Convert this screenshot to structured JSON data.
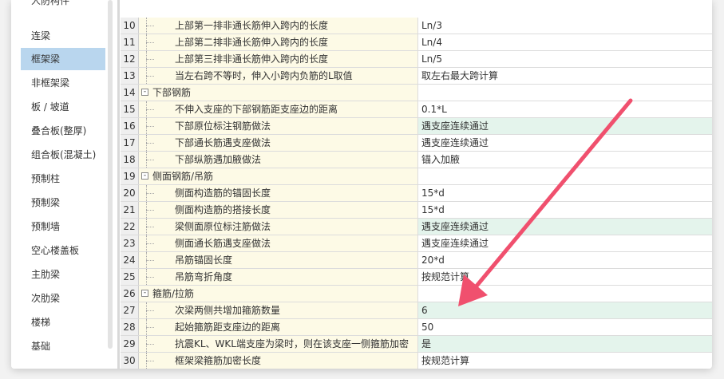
{
  "sidebar": {
    "items": [
      {
        "label": "人防构件",
        "active": false
      },
      {
        "label": "连梁",
        "active": false
      },
      {
        "label": "框架梁",
        "active": true
      },
      {
        "label": "非框架梁",
        "active": false
      },
      {
        "label": "板 / 坡道",
        "active": false
      },
      {
        "label": "叠合板(整厚)",
        "active": false
      },
      {
        "label": "组合板(混凝土)",
        "active": false
      },
      {
        "label": "预制柱",
        "active": false
      },
      {
        "label": "预制梁",
        "active": false
      },
      {
        "label": "预制墙",
        "active": false
      },
      {
        "label": "空心楼盖板",
        "active": false
      },
      {
        "label": "主肋梁",
        "active": false
      },
      {
        "label": "次肋梁",
        "active": false
      },
      {
        "label": "楼梯",
        "active": false
      },
      {
        "label": "基础",
        "active": false
      }
    ]
  },
  "table": {
    "rows": [
      {
        "num": "10",
        "type": "item",
        "name": "上部第一排非通长筋伸入跨内的长度",
        "value": "Ln/3",
        "highlight": false
      },
      {
        "num": "11",
        "type": "item",
        "name": "上部第二排非通长筋伸入跨内的长度",
        "value": "Ln/4",
        "highlight": false
      },
      {
        "num": "12",
        "type": "item",
        "name": "上部第三排非通长筋伸入跨内的长度",
        "value": "Ln/5",
        "highlight": false
      },
      {
        "num": "13",
        "type": "item",
        "name": "当左右跨不等时，伸入小跨内负筋的L取值",
        "value": "取左右最大跨计算",
        "highlight": false
      },
      {
        "num": "14",
        "type": "group",
        "name": "下部钢筋",
        "value": "",
        "expander": "-",
        "highlight": false
      },
      {
        "num": "15",
        "type": "item",
        "name": "不伸入支座的下部钢筋距支座边的距离",
        "value": "0.1*L",
        "highlight": false
      },
      {
        "num": "16",
        "type": "item",
        "name": "下部原位标注钢筋做法",
        "value": "遇支座连续通过",
        "highlight": true
      },
      {
        "num": "17",
        "type": "item",
        "name": "下部通长筋遇支座做法",
        "value": "遇支座连续通过",
        "highlight": false
      },
      {
        "num": "18",
        "type": "item",
        "name": "下部纵筋遇加腋做法",
        "value": "锚入加腋",
        "highlight": false
      },
      {
        "num": "19",
        "type": "group",
        "name": "侧面钢筋/吊筋",
        "value": "",
        "expander": "-",
        "highlight": false
      },
      {
        "num": "20",
        "type": "item",
        "name": "侧面构造筋的锚固长度",
        "value": "15*d",
        "highlight": false
      },
      {
        "num": "21",
        "type": "item",
        "name": "侧面构造筋的搭接长度",
        "value": "15*d",
        "highlight": false
      },
      {
        "num": "22",
        "type": "item",
        "name": "梁侧面原位标注筋做法",
        "value": "遇支座连续通过",
        "highlight": true
      },
      {
        "num": "23",
        "type": "item",
        "name": "侧面通长筋遇支座做法",
        "value": "遇支座连续通过",
        "highlight": false
      },
      {
        "num": "24",
        "type": "item",
        "name": "吊筋锚固长度",
        "value": "20*d",
        "highlight": false
      },
      {
        "num": "25",
        "type": "item",
        "name": "吊筋弯折角度",
        "value": "按规范计算",
        "highlight": false
      },
      {
        "num": "26",
        "type": "group",
        "name": "箍筋/拉筋",
        "value": "",
        "expander": "-",
        "highlight": false
      },
      {
        "num": "27",
        "type": "item",
        "name": "次梁两侧共增加箍筋数量",
        "value": "6",
        "highlight": true
      },
      {
        "num": "28",
        "type": "item",
        "name": "起始箍筋距支座边的距离",
        "value": "50",
        "highlight": false
      },
      {
        "num": "29",
        "type": "item",
        "name": "抗震KL、WKL端支座为梁时，则在该支座一侧箍筋加密",
        "value": "是",
        "highlight": true
      },
      {
        "num": "30",
        "type": "item",
        "name": "框架梁箍筋加密长度",
        "value": "按规范计算",
        "highlight": false
      }
    ]
  },
  "annotation": {
    "color": "#f0506e"
  }
}
